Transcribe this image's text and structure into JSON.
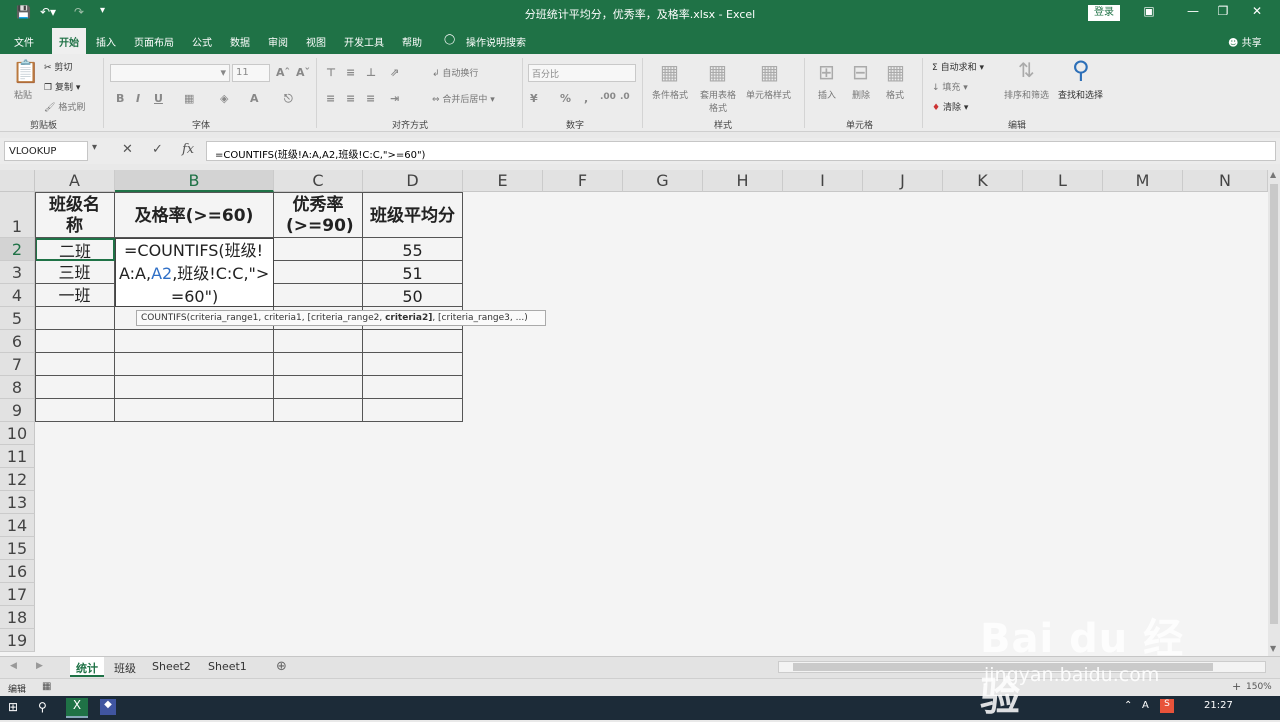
{
  "window": {
    "title": "分班统计平均分，优秀率，及格率.xlsx - Excel",
    "login_label": "登录"
  },
  "ribbon_tabs": [
    "文件",
    "开始",
    "插入",
    "页面布局",
    "公式",
    "数据",
    "审阅",
    "视图",
    "开发工具",
    "帮助",
    "操作说明搜索"
  ],
  "share_label": "共享",
  "ribbon": {
    "clipboard": {
      "paste": "粘贴",
      "cut": "剪切",
      "copy": "复制",
      "format_painter": "格式刷",
      "group": "剪贴板"
    },
    "font": {
      "size": "11",
      "group": "字体",
      "bold": "B",
      "italic": "I",
      "underline": "U"
    },
    "alignment": {
      "wrap": "自动换行",
      "merge": "合并后居中",
      "group": "对齐方式"
    },
    "number": {
      "format": "百分比",
      "group": "数字"
    },
    "styles": {
      "conditional": "条件格式",
      "table": "套用表格格式",
      "cell": "单元格样式",
      "group": "样式"
    },
    "cells": {
      "insert": "插入",
      "delete": "删除",
      "format": "格式",
      "group": "单元格"
    },
    "editing": {
      "autosum": "自动求和",
      "fill": "填充",
      "clear": "清除",
      "sort": "排序和筛选",
      "find": "查找和选择",
      "group": "编辑"
    }
  },
  "formula_bar": {
    "name_box": "VLOOKUP",
    "formula": "=COUNTIFS(班级!A:A,A2,班级!C:C,\">=60\")"
  },
  "columns": [
    "A",
    "B",
    "C",
    "D",
    "E",
    "F",
    "G",
    "H",
    "I",
    "J",
    "K",
    "L",
    "M",
    "N"
  ],
  "rows": [
    "1",
    "2",
    "3",
    "4",
    "5",
    "6",
    "7",
    "8",
    "9",
    "10",
    "11",
    "12",
    "13",
    "14",
    "15",
    "16",
    "17",
    "18",
    "19"
  ],
  "table": {
    "headers": [
      "班级名称",
      "及格率(>=60)",
      "优秀率(>=90)",
      "班级平均分"
    ],
    "class_names": [
      "二班",
      "三班",
      "一班"
    ],
    "averages": [
      "55",
      "51",
      "50"
    ]
  },
  "edit_cell": {
    "line1": "=COUNTIFS(班级!",
    "line2_a": "A:A,",
    "line2_ref": "A2",
    "line2_b": ",班级!C:C,\">",
    "line3": "=60\")"
  },
  "tooltip": {
    "before": "COUNTIFS(criteria_range1, criteria1, [criteria_range2, ",
    "bold": "criteria2]",
    "after": ", [criteria_range3, ...)"
  },
  "sheet_tabs": [
    "统计",
    "班级",
    "Sheet2",
    "Sheet1"
  ],
  "status": {
    "mode": "编辑",
    "zoom": "150%"
  },
  "taskbar": {
    "time": "21:27",
    "ime": "A"
  },
  "watermark": {
    "logo": "Bai du 经验",
    "url": "jingyan.baidu.com"
  },
  "colors": {
    "excel_green": "#1f7246",
    "ref_blue": "#2f6fc6"
  }
}
